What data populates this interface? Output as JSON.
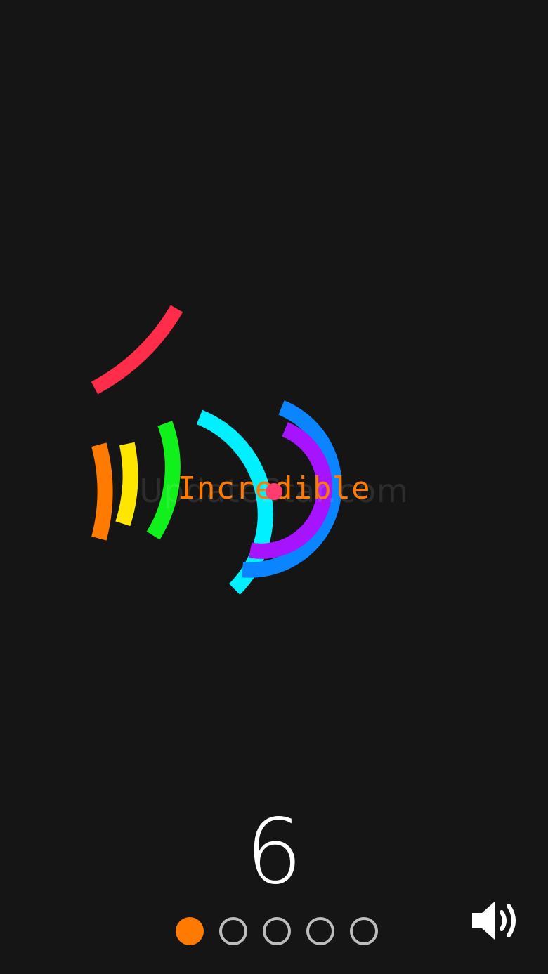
{
  "game": {
    "watermark_text": "UpdateStar.com",
    "feedback_text": "Incredible",
    "score": "6",
    "center_dot_color": "#ff3c6e",
    "feedback_color": "#ff7a00"
  },
  "arcs": [
    {
      "name": "arc-orange",
      "color": "#ff7a00"
    },
    {
      "name": "arc-yellow",
      "color": "#ffe600"
    },
    {
      "name": "arc-green",
      "color": "#10f01a"
    },
    {
      "name": "arc-cyan",
      "color": "#00f0ff"
    },
    {
      "name": "arc-blue",
      "color": "#0a84ff"
    },
    {
      "name": "arc-purple",
      "color": "#a614ff"
    },
    {
      "name": "arc-red",
      "color": "#ff2d4a"
    }
  ],
  "progress": {
    "total": 5,
    "current": 1,
    "active_color": "#ff7a00",
    "inactive_color": "#bdbdbd"
  },
  "controls": {
    "sound_icon": "speaker-on-icon"
  }
}
